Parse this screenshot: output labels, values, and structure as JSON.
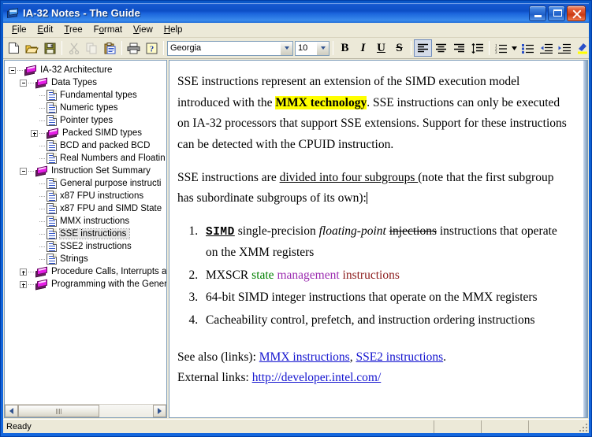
{
  "window": {
    "title": "IA-32 Notes - The Guide",
    "icon": "book-icon",
    "buttons": {
      "minimize": "minimize-button",
      "maximize": "maximize-button",
      "close": "close-button"
    }
  },
  "menubar": {
    "items": [
      {
        "label": "File",
        "accel": "F"
      },
      {
        "label": "Edit",
        "accel": "E"
      },
      {
        "label": "Tree",
        "accel": "T"
      },
      {
        "label": "Format",
        "accel": "o"
      },
      {
        "label": "View",
        "accel": "V"
      },
      {
        "label": "Help",
        "accel": "H"
      }
    ]
  },
  "toolbar": {
    "buttons": [
      {
        "name": "new-icon",
        "title": "New"
      },
      {
        "name": "open-icon",
        "title": "Open"
      },
      {
        "name": "save-icon",
        "title": "Save"
      },
      {
        "name": "cut-icon",
        "title": "Cut",
        "disabled": true
      },
      {
        "name": "copy-icon",
        "title": "Copy",
        "disabled": true
      },
      {
        "name": "paste-icon",
        "title": "Paste"
      },
      {
        "name": "print-icon",
        "title": "Print"
      },
      {
        "name": "help-icon",
        "title": "Help"
      }
    ],
    "font_name": "Georgia",
    "font_size": "10",
    "format_buttons": [
      {
        "name": "bold-button",
        "glyph": "B"
      },
      {
        "name": "italic-button",
        "glyph": "I"
      },
      {
        "name": "underline-button",
        "glyph": "U"
      },
      {
        "name": "strikethrough-button",
        "glyph": "S"
      }
    ],
    "align_buttons": [
      {
        "name": "align-left-button",
        "active": true
      },
      {
        "name": "align-center-button",
        "active": false
      },
      {
        "name": "align-right-button",
        "active": false
      },
      {
        "name": "line-spacing-button",
        "active": false
      }
    ],
    "list_buttons": [
      {
        "name": "numbered-list-button"
      },
      {
        "name": "bulleted-list-button"
      },
      {
        "name": "decrease-indent-button"
      },
      {
        "name": "increase-indent-button"
      },
      {
        "name": "highlight-color-button"
      }
    ]
  },
  "tree": {
    "nodes": [
      {
        "label": "IA-32 Architecture",
        "level": 0,
        "icon": "book",
        "expander": "minus",
        "selected": false
      },
      {
        "label": "Data Types",
        "level": 1,
        "icon": "book",
        "expander": "minus",
        "selected": false
      },
      {
        "label": "Fundamental types",
        "level": 2,
        "icon": "document",
        "expander": "none",
        "selected": false
      },
      {
        "label": "Numeric types",
        "level": 2,
        "icon": "document",
        "expander": "none",
        "selected": false
      },
      {
        "label": "Pointer types",
        "level": 2,
        "icon": "document",
        "expander": "none",
        "selected": false
      },
      {
        "label": "Packed SIMD types",
        "level": 2,
        "icon": "book",
        "expander": "plus",
        "selected": false
      },
      {
        "label": "BCD and packed BCD",
        "level": 2,
        "icon": "document",
        "expander": "none",
        "selected": false
      },
      {
        "label": "Real Numbers and Floatin",
        "level": 2,
        "icon": "document",
        "expander": "none",
        "selected": false
      },
      {
        "label": "Instruction Set Summary",
        "level": 1,
        "icon": "book",
        "expander": "minus",
        "selected": false
      },
      {
        "label": "General purpose instructi",
        "level": 2,
        "icon": "document",
        "expander": "none",
        "selected": false
      },
      {
        "label": "x87 FPU instructions",
        "level": 2,
        "icon": "document",
        "expander": "none",
        "selected": false
      },
      {
        "label": "x87 FPU and SIMD State",
        "level": 2,
        "icon": "document",
        "expander": "none",
        "selected": false
      },
      {
        "label": "MMX instructions",
        "level": 2,
        "icon": "document",
        "expander": "none",
        "selected": false
      },
      {
        "label": "SSE instructions",
        "level": 2,
        "icon": "document",
        "expander": "none",
        "selected": true
      },
      {
        "label": "SSE2 instructions",
        "level": 2,
        "icon": "document",
        "expander": "none",
        "selected": false
      },
      {
        "label": "Strings",
        "level": 2,
        "icon": "document",
        "expander": "none",
        "selected": false
      },
      {
        "label": "Procedure Calls, Interrupts a",
        "level": 1,
        "icon": "book",
        "expander": "plus",
        "selected": false
      },
      {
        "label": "Programming with the Genera",
        "level": 1,
        "icon": "book",
        "expander": "plus",
        "selected": false
      }
    ]
  },
  "document": {
    "para1": {
      "t1": "SSE instructions represent an extension of the SIMD execution model introduced with the ",
      "highlight": "MMX technology",
      "t2": ". SSE instructions can only be executed on IA-32 processors that support SSE extensions. Support for these instructions can be detected with the CPUID instruction."
    },
    "para2": {
      "t1": "SSE instructions are ",
      "underlined": "divided into four subgroups ",
      "t2": "(note that the first subgroup has subordinate subgroups of its own):"
    },
    "list": [
      {
        "mono": "SIMD",
        "t1": " single-precision ",
        "italic": "floating-point",
        "t2": " ",
        "strike": "injections",
        "t3": " instructions that operate on the XMM registers"
      },
      {
        "t1": "MXSCR ",
        "green": "state",
        "t2": " ",
        "purple": "management",
        "t3": " ",
        "maroon": "instructions"
      },
      {
        "t1": "64-bit SIMD integer instructions that operate on the MMX registers"
      },
      {
        "t1": "Cacheability control, prefetch, and instruction ordering instructions"
      }
    ],
    "see_also": {
      "prefix": "See also (links): ",
      "link1": "MMX instructions",
      "sep": ", ",
      "link2": "SSE2 instructions",
      "suffix": "."
    },
    "external": {
      "prefix": "External links: ",
      "link": "http://developer.intel.com/"
    }
  },
  "statusbar": {
    "message": "Ready",
    "panel2": "",
    "panel3": "",
    "panel4": ""
  },
  "colors": {
    "highlight": "#ffff00",
    "link": "#1414cf",
    "green": "#008000",
    "purple": "#9b2bb0",
    "maroon": "#8b1a1a",
    "titlebar": "#0e63d6",
    "selection": "#e4e4e4"
  }
}
